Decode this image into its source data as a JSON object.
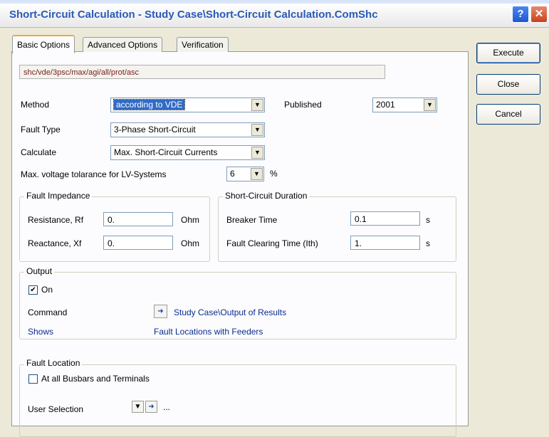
{
  "window": {
    "title": "Short-Circuit Calculation - Study Case\\Short-Circuit Calculation.ComShc"
  },
  "tabs": [
    "Basic Options",
    "Advanced Options",
    "Verification"
  ],
  "command_path": "shc/vde/3psc/max/agi/all/prot/asc",
  "buttons": {
    "execute": "Execute",
    "close": "Close",
    "cancel": "Cancel"
  },
  "method": {
    "label": "Method",
    "value": "according to VDE",
    "published_label": "Published",
    "published_value": "2001"
  },
  "fault_type": {
    "label": "Fault Type",
    "value": "3-Phase Short-Circuit"
  },
  "calculate": {
    "label": "Calculate",
    "value": "Max. Short-Circuit Currents"
  },
  "voltage_tolerance": {
    "label": "Max. voltage tolarance for LV-Systems",
    "value": "6",
    "unit": "%"
  },
  "fault_impedance": {
    "title": "Fault Impedance",
    "resistance_label": "Resistance, Rf",
    "resistance_value": "0.",
    "resistance_unit": "Ohm",
    "reactance_label": "Reactance, Xf",
    "reactance_value": "0.",
    "reactance_unit": "Ohm"
  },
  "sc_duration": {
    "title": "Short-Circuit Duration",
    "breaker_label": "Breaker Time",
    "breaker_value": "0.1",
    "breaker_unit": "s",
    "clearing_label": "Fault Clearing Time (Ith)",
    "clearing_value": "1.",
    "clearing_unit": "s"
  },
  "output": {
    "title": "Output",
    "on_label": "On",
    "on_checked": true,
    "command_label": "Command",
    "command_value": "Study Case\\Output of Results",
    "shows_label": "Shows",
    "shows_value": "Fault Locations with Feeders"
  },
  "fault_location": {
    "title": "Fault Location",
    "all_busbars_label": "At all Busbars and Terminals",
    "all_busbars_checked": false,
    "user_selection_label": "User Selection",
    "user_selection_value": "..."
  }
}
